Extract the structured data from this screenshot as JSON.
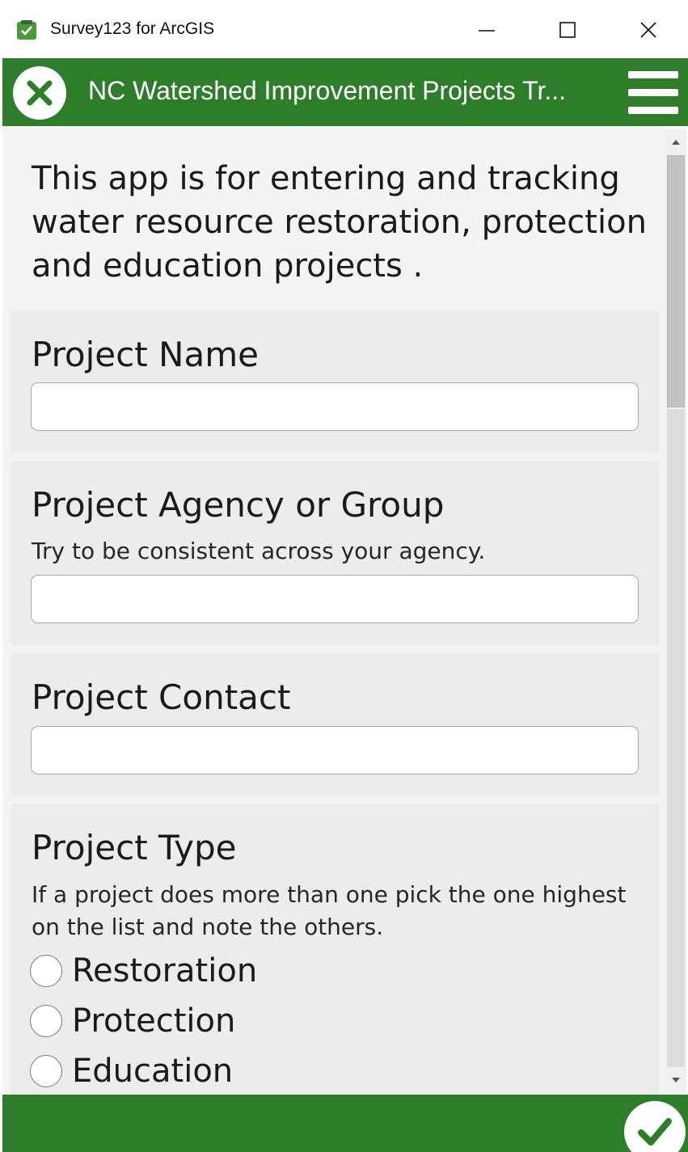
{
  "window": {
    "title": "Survey123 for ArcGIS",
    "app_icon": "survey123-icon",
    "controls": [
      "minimize-icon",
      "maximize-icon",
      "close-icon"
    ]
  },
  "header": {
    "title": "NC Watershed Improvement Projects Tr...",
    "close_icon": "close-circle-icon",
    "menu_icon": "hamburger-menu-icon",
    "color": "#2e7d2a"
  },
  "form": {
    "intro": "This app is for entering and tracking water resource restoration, protection and education projects .",
    "project_name": {
      "label": "Project Name",
      "value": ""
    },
    "project_agency": {
      "label": "Project Agency or Group",
      "hint": "Try to be consistent across your agency.",
      "value": ""
    },
    "project_contact": {
      "label": "Project Contact",
      "value": ""
    },
    "project_type": {
      "label": "Project Type",
      "hint": "If a project does more than one pick the one highest on the list and note the others.",
      "options": [
        "Restoration",
        "Protection",
        "Education"
      ]
    }
  },
  "footer": {
    "submit_icon": "checkmark-circle-icon"
  }
}
